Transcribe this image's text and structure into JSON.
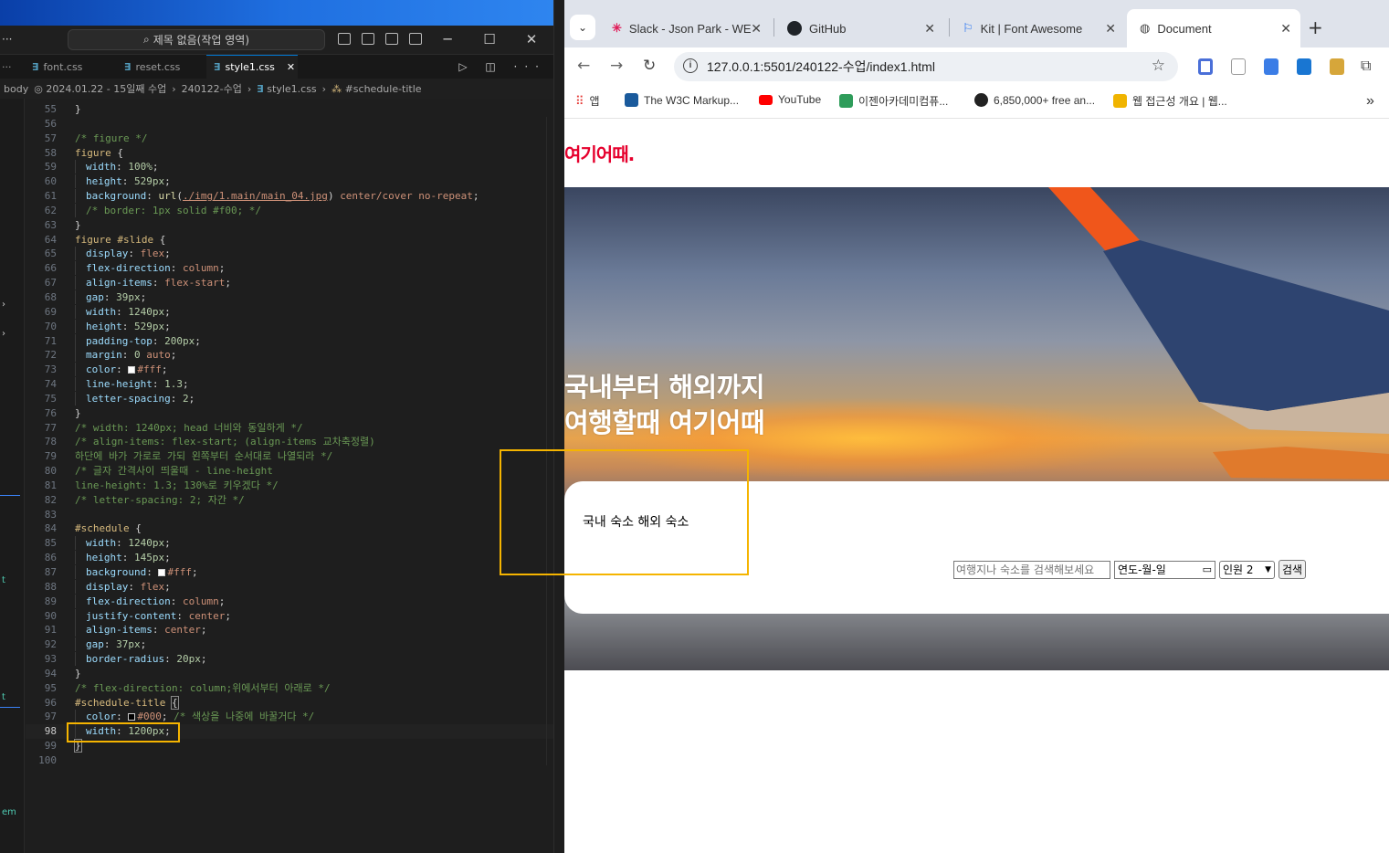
{
  "vscode": {
    "title": "제목 없음(작업 영역)",
    "tabs": [
      {
        "label": "font.css",
        "active": false
      },
      {
        "label": "reset.css",
        "active": false
      },
      {
        "label": "style1.css",
        "active": true
      }
    ],
    "breadcrumb": [
      "body",
      "2024.01.22 - 15일째 수업",
      "240122-수업",
      "style1.css",
      "#schedule-title"
    ],
    "current_line": 98
  },
  "chrome": {
    "tabs": [
      {
        "label": "Slack - Json Park - WE",
        "icon": "slack-icon",
        "active": false
      },
      {
        "label": "GitHub",
        "icon": "github-icon",
        "active": false
      },
      {
        "label": "Kit | Font Awesome",
        "icon": "flag-icon",
        "active": false
      },
      {
        "label": "Document",
        "icon": "globe-icon",
        "active": true
      }
    ],
    "url": "127.0.0.1:5501/240122-수업/index1.html",
    "bookmarks": [
      {
        "label": "앱",
        "icon": "apps-icon"
      },
      {
        "label": "The W3C Markup...",
        "icon": "w3c-icon"
      },
      {
        "label": "YouTube",
        "icon": "youtube-icon"
      },
      {
        "label": "이젠아카데미컴퓨...",
        "icon": "ezen-icon"
      },
      {
        "label": "6,850,000+ free an...",
        "icon": "freepik-icon"
      },
      {
        "label": "웹 접근성 개요 | 웹...",
        "icon": "web-accessibility-icon"
      }
    ]
  },
  "page": {
    "logo": "여기어때.",
    "hero_line1": "국내부터 해외까지",
    "hero_line2": "여행할때 여기어때",
    "schedule_title": "국내 숙소 해외 숙소",
    "search_placeholder": "여행지나 숙소를 검색해보세요",
    "date_placeholder": "연도-월-일",
    "people_value": "인원 2",
    "search_button": "검색"
  },
  "colors": {
    "logo": "#e6002d",
    "highlight_box": "#f5b400",
    "editor_bg": "#1e1e1e"
  }
}
